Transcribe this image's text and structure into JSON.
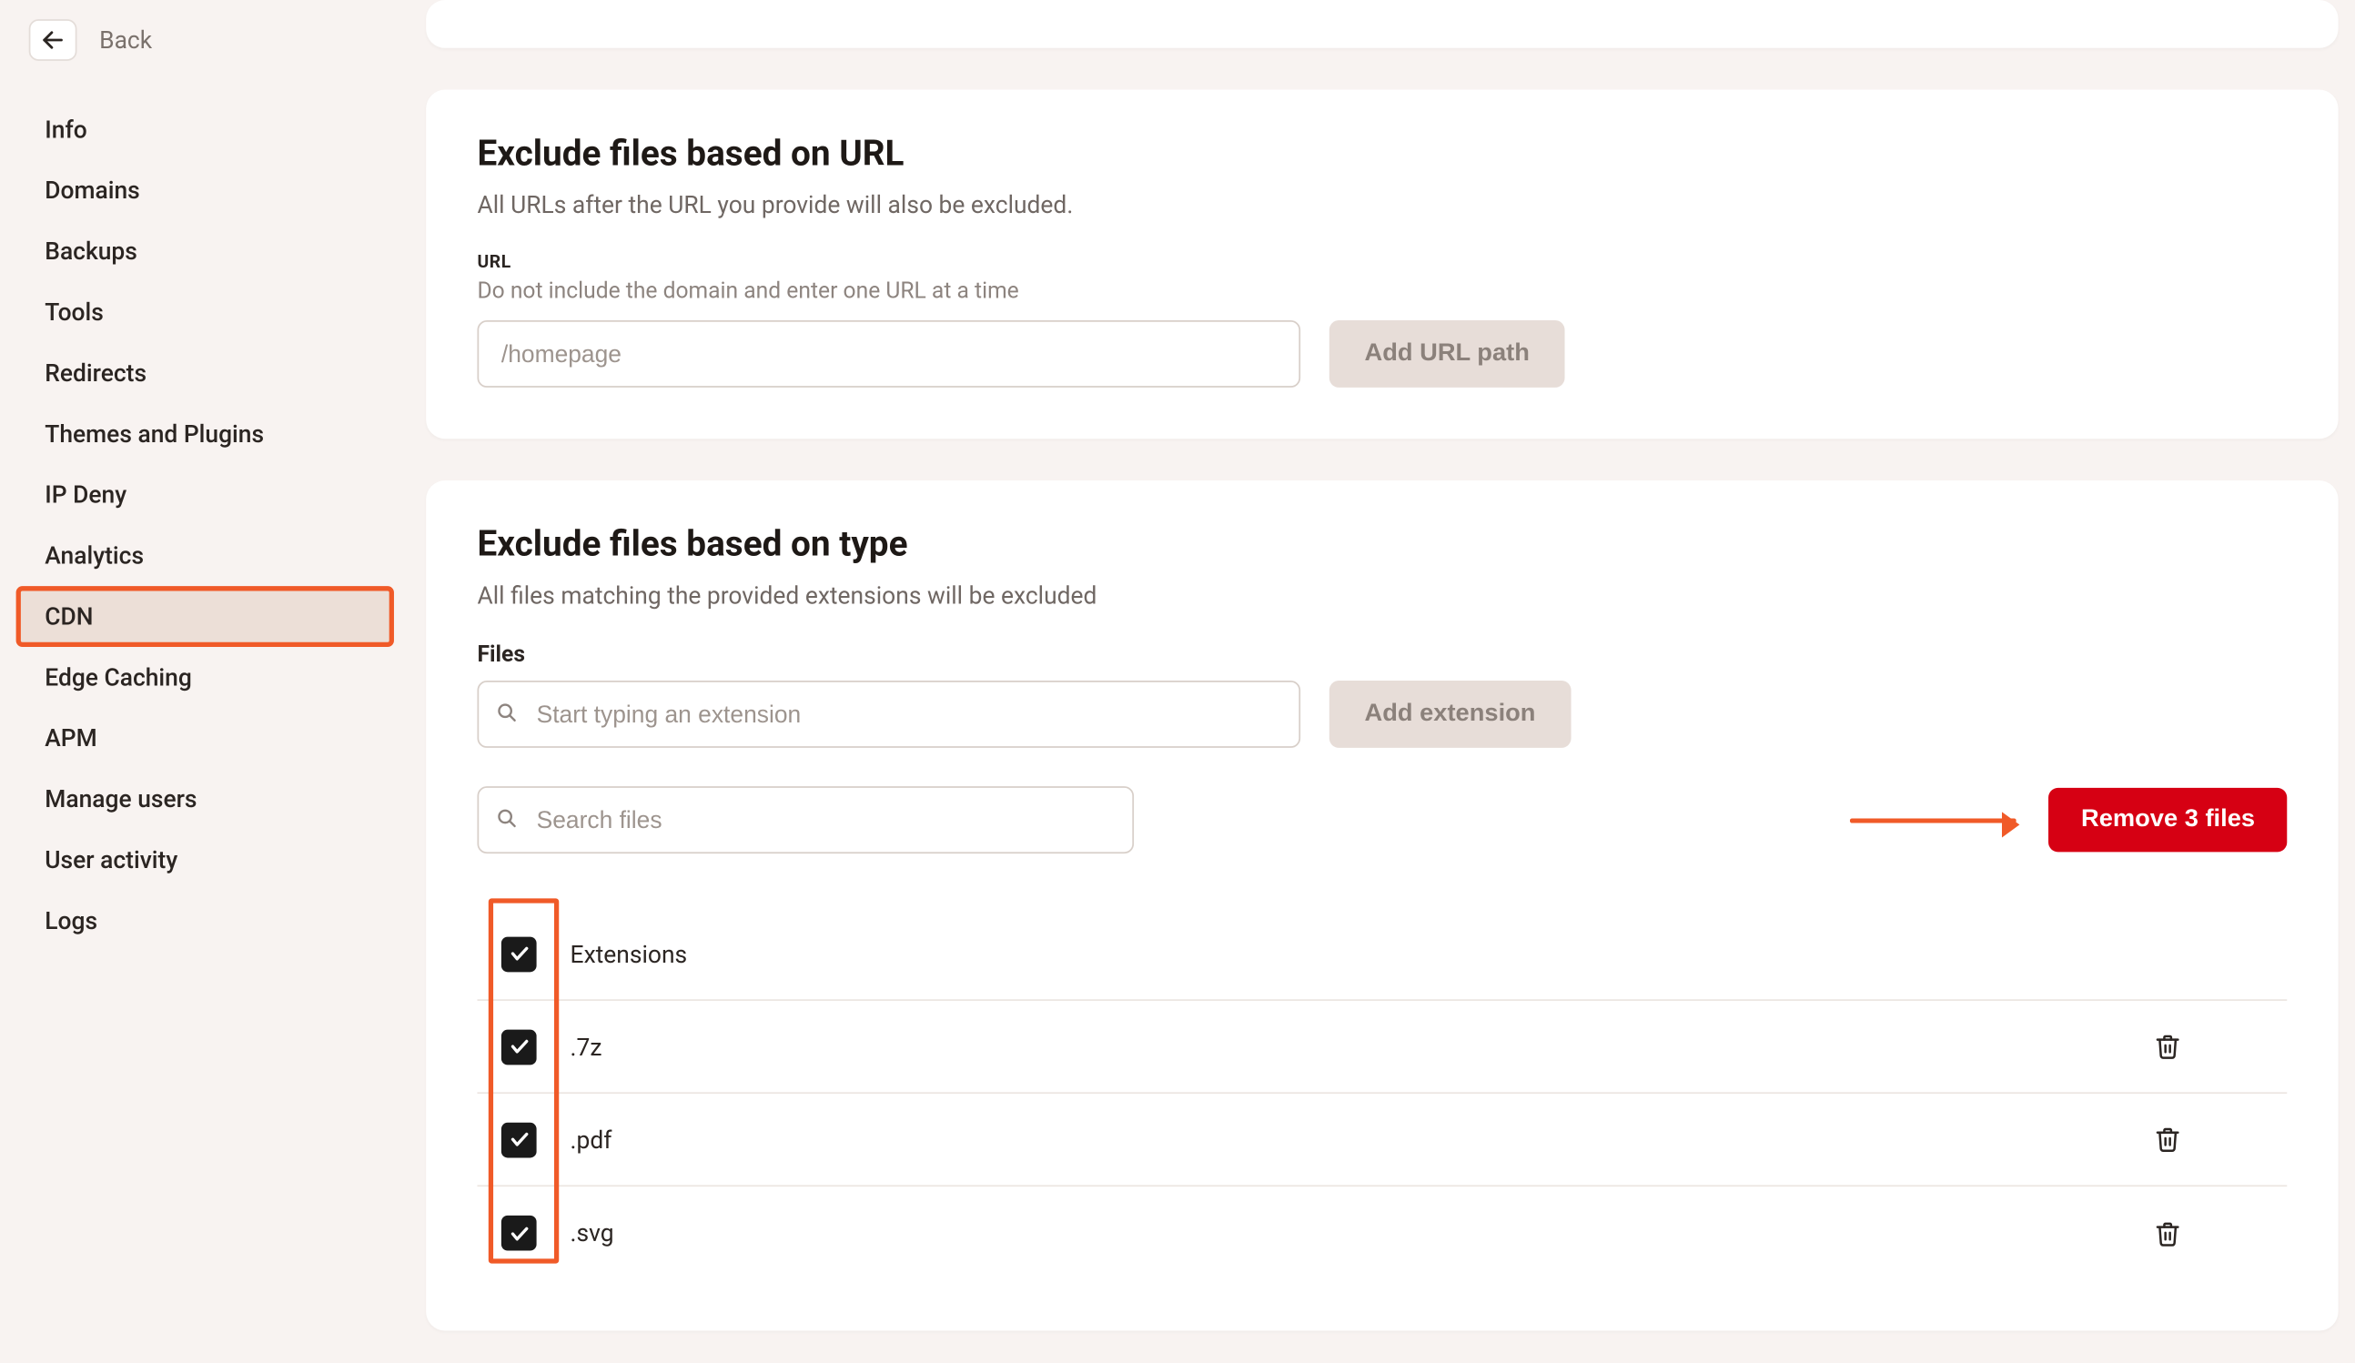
{
  "back": {
    "label": "Back"
  },
  "sidebar": {
    "items": [
      {
        "label": "Info"
      },
      {
        "label": "Domains"
      },
      {
        "label": "Backups"
      },
      {
        "label": "Tools"
      },
      {
        "label": "Redirects"
      },
      {
        "label": "Themes and Plugins"
      },
      {
        "label": "IP Deny"
      },
      {
        "label": "Analytics"
      },
      {
        "label": "CDN"
      },
      {
        "label": "Edge Caching"
      },
      {
        "label": "APM"
      },
      {
        "label": "Manage users"
      },
      {
        "label": "User activity"
      },
      {
        "label": "Logs"
      }
    ],
    "active_index": 8
  },
  "url_card": {
    "title": "Exclude files based on URL",
    "subtitle": "All URLs after the URL you provide will also be excluded.",
    "field_small_label": "URL",
    "helper": "Do not include the domain and enter one URL at a time",
    "placeholder": "/homepage",
    "button": "Add URL path"
  },
  "type_card": {
    "title": "Exclude files based on type",
    "subtitle": "All files matching the provided extensions will be excluded",
    "field_label": "Files",
    "ext_placeholder": "Start typing an extension",
    "add_button": "Add extension",
    "search_placeholder": "Search files",
    "remove_button": "Remove 3 files",
    "header_label": "Extensions",
    "rows": [
      {
        "ext": ".7z"
      },
      {
        "ext": ".pdf"
      },
      {
        "ext": ".svg"
      }
    ]
  }
}
